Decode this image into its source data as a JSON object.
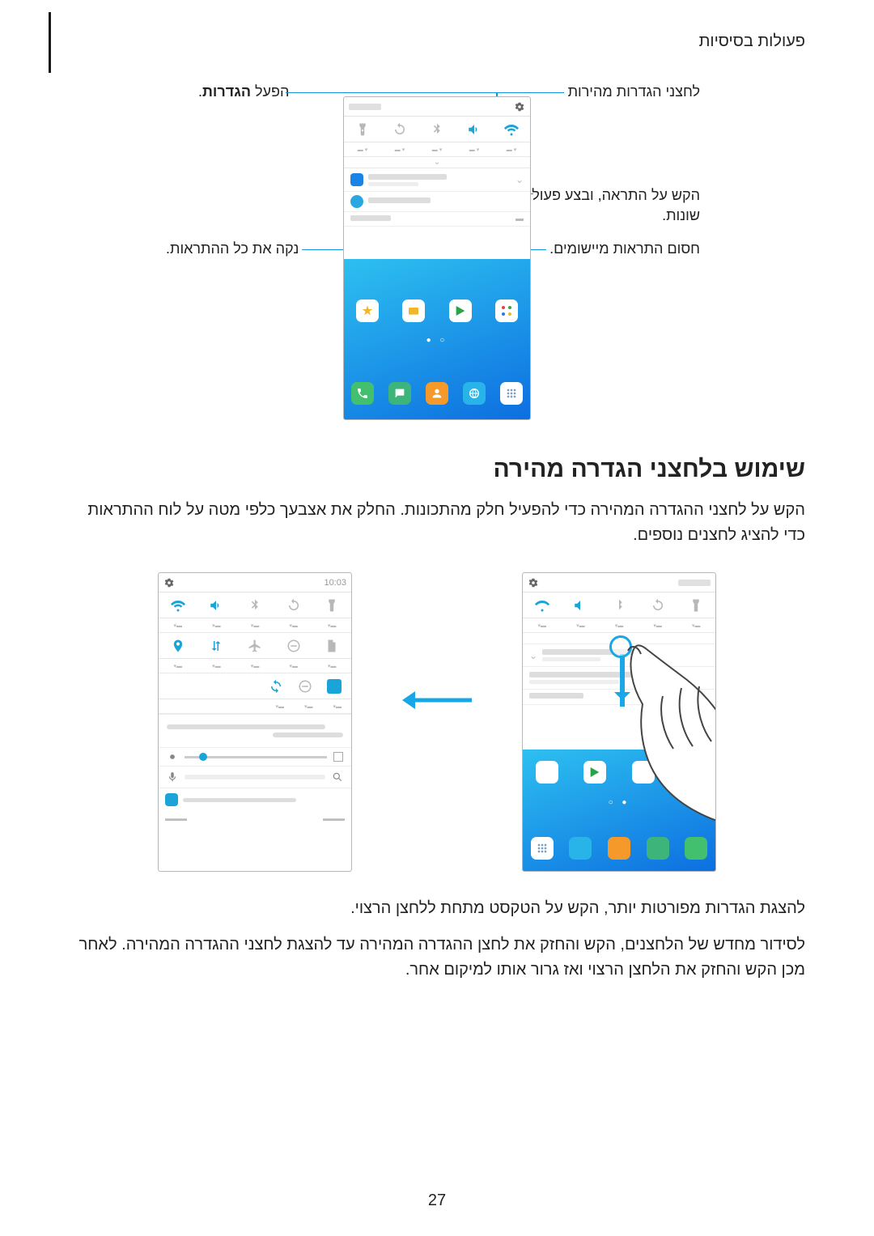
{
  "header": {
    "title": "פעולות בסיסיות"
  },
  "callouts": {
    "qs_buttons": "לחצני הגדרות מהירות",
    "launch_settings_prefix": "הפעל ",
    "launch_settings_bold": "הגדרות",
    "launch_settings_suffix": ".",
    "tap_notification_l1": "הקש על התראה, ובצע פעולות",
    "tap_notification_l2": "שונות.",
    "block_app": "חסום התראות מיישומים.",
    "clear_all": "נקה את כל ההתראות."
  },
  "section": {
    "heading": "שימוש בלחצני הגדרה מהירה",
    "p1": "הקש על לחצני ההגדרה המהירה כדי להפעיל חלק מהתכונות. החלק את אצבעך כלפי מטה על לוח ההתראות כדי להציג לחצנים נוספים.",
    "p2": "להצגת הגדרות מפורטות יותר, הקש על הטקסט מתחת ללחצן הרצוי.",
    "p3": "לסידור מחדש של הלחצנים, הקש והחזק את לחצן ההגדרה המהירה עד להצגת לחצני ההגדרה המהירה. לאחר מכן הקש והחזק את הלחצן הרצוי ואז גרור אותו למיקום אחר."
  },
  "left_phone": {
    "time": "10:03"
  },
  "page_number": "27"
}
